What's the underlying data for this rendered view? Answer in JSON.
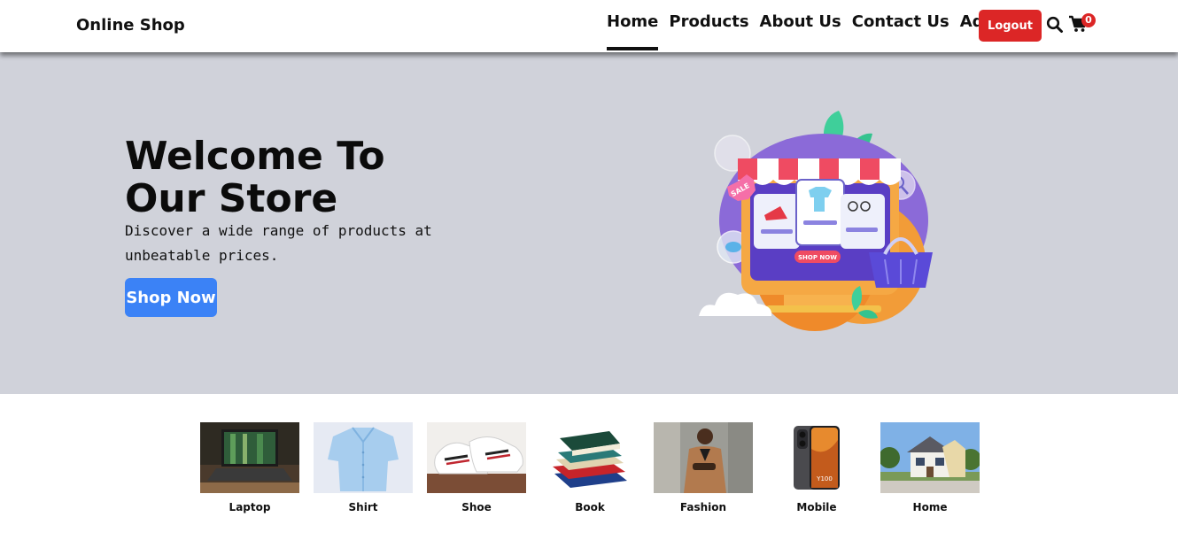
{
  "navbar": {
    "brand": "Online Shop",
    "links": [
      {
        "label": "Home",
        "active": true
      },
      {
        "label": "Products"
      },
      {
        "label": "About Us"
      },
      {
        "label": "Contact Us"
      },
      {
        "label": "Admin"
      }
    ],
    "logout_label": "Logout",
    "cart_count": "0",
    "icons": [
      "search-icon",
      "cart-icon"
    ]
  },
  "hero": {
    "title": "Welcome To Our Store",
    "subtitle": "Discover a wide range of products at unbeatable prices.",
    "cta_label": "Shop Now",
    "illustration_sale": "SALE",
    "illustration_shop_now": "SHOP NOW"
  },
  "categories": [
    {
      "label": "Laptop"
    },
    {
      "label": "Shirt"
    },
    {
      "label": "Shoe"
    },
    {
      "label": "Book"
    },
    {
      "label": "Fashion"
    },
    {
      "label": "Mobile"
    },
    {
      "label": "Home"
    }
  ],
  "colors": {
    "hero_bg": "#d0d2da",
    "logout": "#dc2626",
    "cta": "#3b82f6",
    "badge": "#dc2626"
  }
}
